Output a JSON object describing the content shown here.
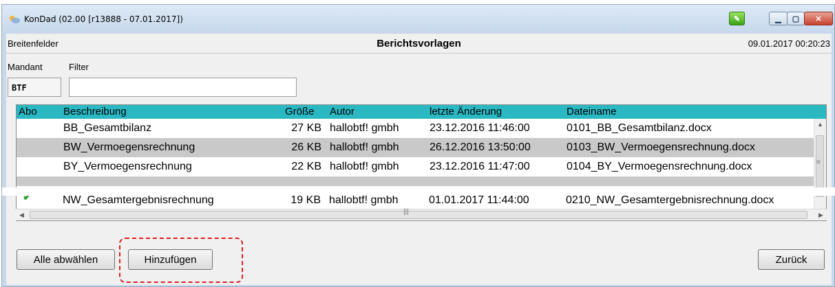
{
  "window": {
    "title": "KonDad (02.00 [r13888 - 07.01.2017])",
    "icon": "sun-app-icon",
    "controls": [
      "minimize",
      "maximize",
      "close"
    ]
  },
  "header": {
    "left": "Breitenfelder",
    "center": "Berichtsvorlagen",
    "right": "09.01.2017 00:20:23"
  },
  "fields": {
    "mandant_label": "Mandant",
    "filter_label": "Filter",
    "mandant_value": "BTF",
    "filter_value": ""
  },
  "table": {
    "columns": [
      "Abo",
      "Beschreibung",
      "Größe",
      "Autor",
      "letzte Änderung",
      "Dateiname"
    ],
    "rows": [
      {
        "abo": "",
        "beschreibung": "BB_Gesamtbilanz",
        "groesse": "27 KB",
        "autor": "hallobtf! gmbh",
        "aenderung": "23.12.2016 11:46:00",
        "datei": "0101_BB_Gesamtbilanz.docx"
      },
      {
        "abo": "",
        "beschreibung": "BW_Vermoegensrechnung",
        "groesse": "26 KB",
        "autor": "hallobtf! gmbh",
        "aenderung": "26.12.2016 13:50:00",
        "datei": "0103_BW_Vermoegensrechnung.docx"
      },
      {
        "abo": "",
        "beschreibung": "BY_Vermoegensrechnung",
        "groesse": "22 KB",
        "autor": "hallobtf! gmbh",
        "aenderung": "23.12.2016 11:47:00",
        "datei": "0104_BY_Vermoegensrechnung.docx"
      }
    ],
    "partial_row": {
      "abo": "✔",
      "beschreibung": "NW_Gesamtergebnisrechnung",
      "groesse": "19 KB",
      "autor": "hallobtf! gmbh",
      "aenderung": "01.01.2017 11:44:00",
      "datei": "0210_NW_Gesamtergebnisrechnung.docx"
    }
  },
  "buttons": {
    "alle_abwaehlen": "Alle abwählen",
    "hinzufuegen": "Hinzufügen",
    "zurueck": "Zurück"
  },
  "colors": {
    "table_header": "#2ab8c3",
    "selected_row": "#c9c9c9",
    "focus_outline": "#e01b1b"
  }
}
